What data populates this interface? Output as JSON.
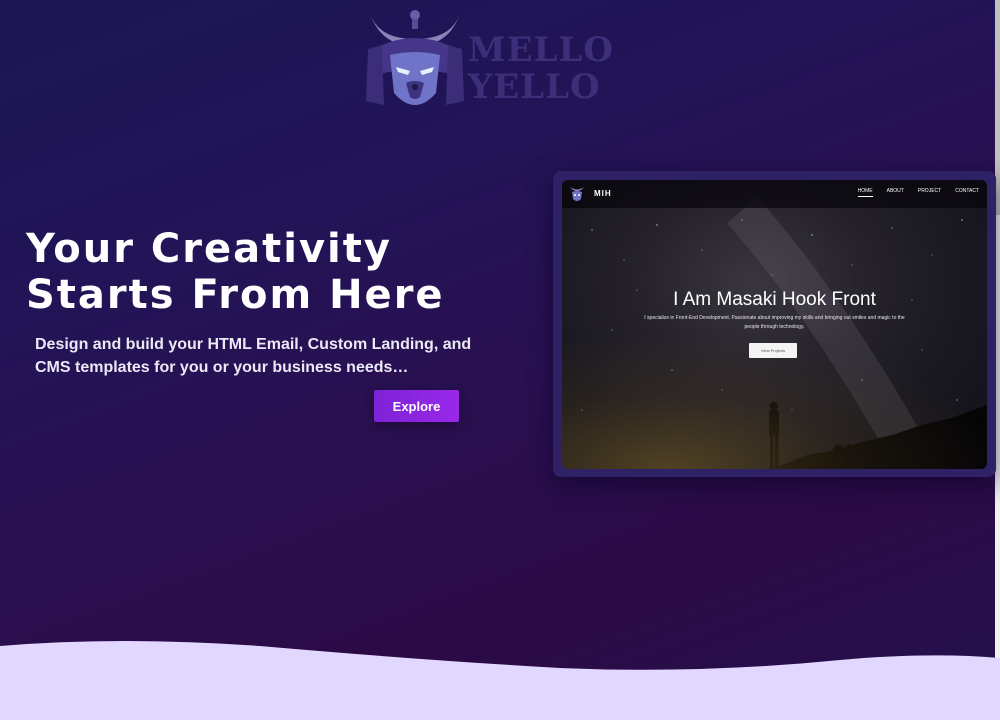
{
  "logo": {
    "line1": "MELLO",
    "line2": "YELLO",
    "icon": "wolf-samurai-icon"
  },
  "hero": {
    "title_line1": "Your Creativity",
    "title_line2": "Starts From Here",
    "subtitle": "Design and build your HTML Email, Custom Landing, and CMS templates for you or your business needs…",
    "cta_label": "Explore"
  },
  "preview": {
    "brand": "MIH",
    "nav": [
      "HOME",
      "ABOUT",
      "PROJECT",
      "CONTACT"
    ],
    "heading": "I Am Masaki Hook Front",
    "text": "I specialize in Front-End Development. Passionate about improving my skills and bringing out smiles and magic to the people through technology.",
    "button_label": "View Projects"
  },
  "colors": {
    "accent": "#8a24e0",
    "wave": "#e2d7ff",
    "card": "#2e2166"
  }
}
